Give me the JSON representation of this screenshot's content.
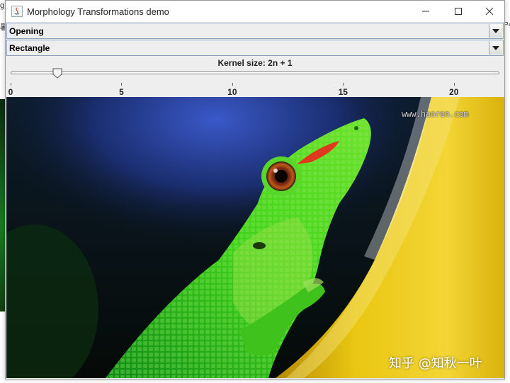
{
  "window": {
    "title": "Morphology Transformations demo",
    "controls": {
      "minimize": "minimize",
      "maximize": "maximize",
      "close": "close"
    }
  },
  "operation_combo": {
    "selected": "Opening"
  },
  "element_combo": {
    "selected": "Rectangle"
  },
  "kernel_slider": {
    "label": "Kernel size: 2n + 1",
    "min": 0,
    "max": 21,
    "value": 2,
    "major_ticks": [
      "0",
      "5",
      "10",
      "15",
      "20"
    ]
  },
  "image": {
    "subject": "green gecko on yellow banana",
    "watermark_top": "www.haoren.com",
    "watermark_bottom": "知乎 @知秋一叶"
  },
  "background": {
    "left_glyph_1": "g",
    "left_glyph_2": "暑",
    "right_glyph": "P4"
  },
  "colors": {
    "titlebar": "#ffffff",
    "panel": "#eeeeee",
    "combo_border": "#8aa0bb",
    "gecko_green": "#3fd21a",
    "banana_yellow": "#e8c412"
  }
}
